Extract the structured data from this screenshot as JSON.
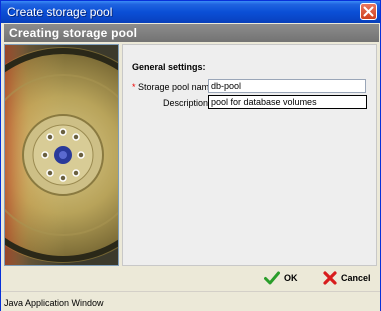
{
  "window": {
    "title": "Create storage pool"
  },
  "header": {
    "title": "Creating storage pool"
  },
  "form": {
    "section_title": "General settings:",
    "name_required_mark": "*",
    "name_label": "Storage pool name:",
    "name_value": "db-pool",
    "description_label": "Description:",
    "description_value": "pool for database volumes"
  },
  "buttons": {
    "ok_label": "OK",
    "cancel_label": "Cancel"
  },
  "status": {
    "text": "Java Application Window"
  },
  "colors": {
    "titlebar": "#0a4fd6",
    "header": "#808080",
    "ok_icon": "#2a9d2a",
    "cancel_icon": "#d81c1c"
  }
}
